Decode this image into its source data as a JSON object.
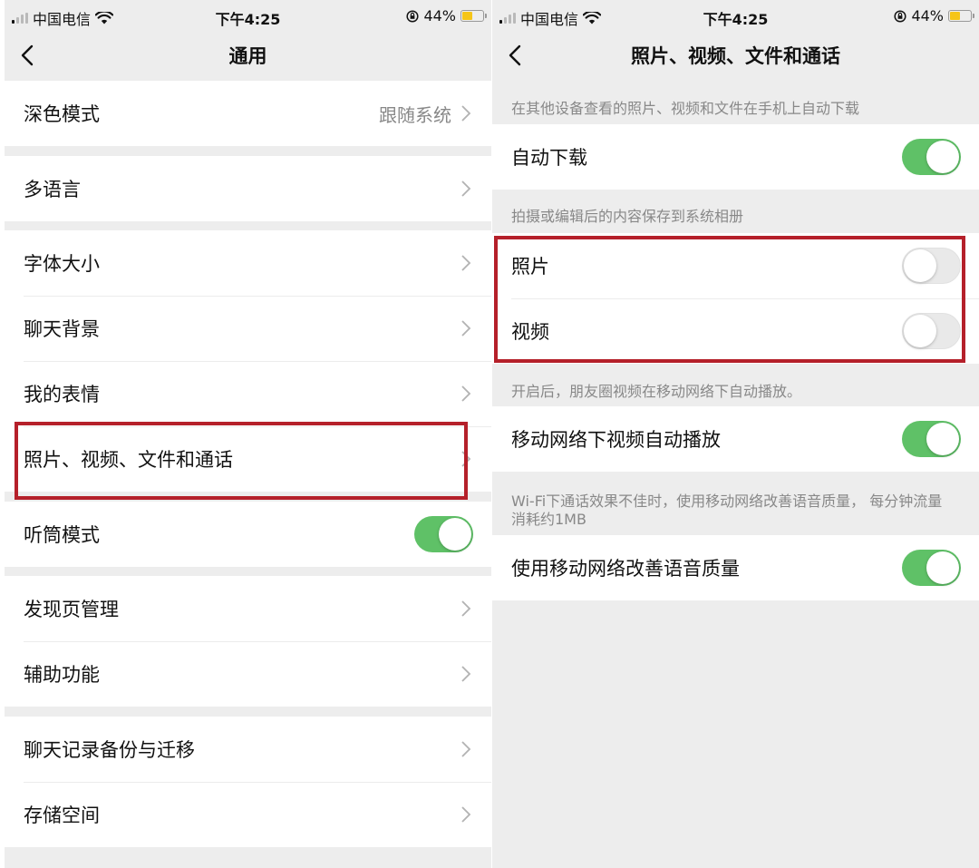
{
  "status_bar": {
    "carrier": "中国电信",
    "time": "下午4:25",
    "battery": "44%",
    "battery_level": 0.44
  },
  "left_screen": {
    "title": "通用",
    "dark_mode": {
      "label": "深色模式",
      "value": "跟随系统"
    },
    "language": {
      "label": "多语言"
    },
    "font_size": {
      "label": "字体大小"
    },
    "chat_bg": {
      "label": "聊天背景"
    },
    "stickers": {
      "label": "我的表情"
    },
    "media": {
      "label": "照片、视频、文件和通话"
    },
    "earpiece": {
      "label": "听筒模式",
      "on": true
    },
    "discover": {
      "label": "发现页管理"
    },
    "accessibility": {
      "label": "辅助功能"
    },
    "backup": {
      "label": "聊天记录备份与迁移"
    },
    "storage": {
      "label": "存储空间"
    }
  },
  "right_screen": {
    "title": "照片、视频、文件和通话",
    "desc1": "在其他设备查看的照片、视频和文件在手机上自动下载",
    "auto_download": {
      "label": "自动下载",
      "on": true
    },
    "desc2": "拍摄或编辑后的内容保存到系统相册",
    "photos": {
      "label": "照片",
      "on": false
    },
    "videos": {
      "label": "视频",
      "on": false
    },
    "desc3": "开启后，朋友圈视频在移动网络下自动播放。",
    "autoplay": {
      "label": "移动网络下视频自动播放",
      "on": true
    },
    "desc4": "Wi-Fi下通话效果不佳时，使用移动网络改善语音质量， 每分钟流量消耗约1MB",
    "improve_voice": {
      "label": "使用移动网络改善语音质量",
      "on": true
    }
  },
  "colors": {
    "switch_on": "#5fc167",
    "highlight": "#b5202a",
    "background": "#ededed"
  }
}
